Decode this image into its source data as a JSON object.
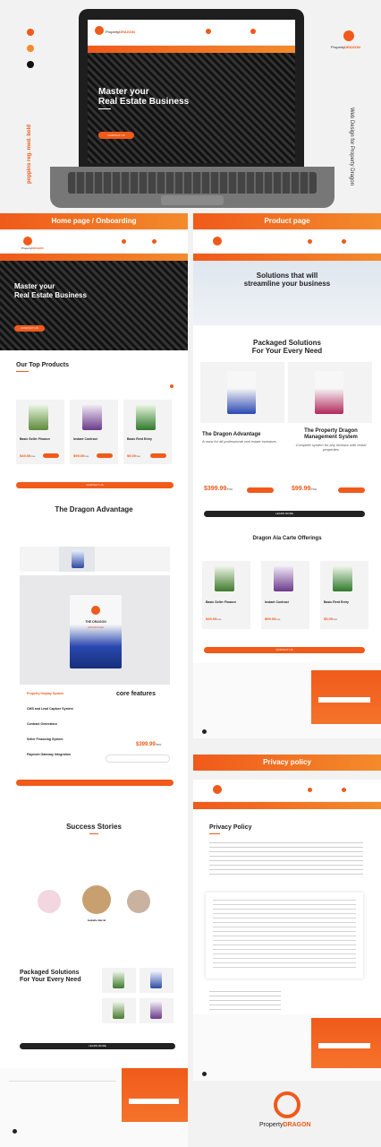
{
  "brand": {
    "name_left": "Property",
    "name_right": "DRAGON"
  },
  "side_text": {
    "fonts": "poppins reg. med. bold",
    "credit": "Web Design for Property Dragon"
  },
  "section_labels": {
    "home": "Home page / Onboarding",
    "product": "Product page",
    "privacy": "Privacy policy"
  },
  "laptop": {
    "hero_title_1": "Master your",
    "hero_title_2": "Real Estate Business",
    "hero_button": "CONTACT US"
  },
  "home": {
    "hero_title_1": "Master your",
    "hero_title_2": "Real Estate Business",
    "hero_button": "CONTACT US",
    "top_products_title": "Our Top Products",
    "products": [
      {
        "name": "Basic Seller Finance",
        "price": "$49.00",
        "unit": "/mo"
      },
      {
        "name": "Instant Contract",
        "price": "$99.00",
        "unit": "/mo"
      },
      {
        "name": "Basic Rent Entry",
        "price": "$9.00",
        "unit": "/mo"
      }
    ],
    "contact_button": "CONTACT US",
    "advantage_title": "The Dragon Advantage",
    "box_label_1": "THE DRAGON",
    "box_label_2": "ADVANTAGE",
    "features_list": [
      "Property Display System",
      "CMS and Lead Capture System",
      "Contract Generation",
      "Seller Financing System",
      "Payment Gateway Integration"
    ],
    "core_features_title": "core features",
    "core_price": "$399.99",
    "core_price_unit": "/mo",
    "success_title": "Success Stories",
    "testimonial_name": "Isabelle Berrel",
    "packaged_title_1": "Packaged Solutions",
    "packaged_title_2": "For Your Every Need",
    "learn_more": "LEARN MORE"
  },
  "product": {
    "hero_title_1": "Solutions that will",
    "hero_title_2": "streamline your business",
    "packaged_title_1": "Packaged Solutions",
    "packaged_title_2": "For Your Every Need",
    "plan_1_title": "The Dragon Advantage",
    "plan_1_sub": "A must for all professional real estate investors",
    "plan_1_price": "$399.99",
    "plan_1_unit": "/mo",
    "plan_2_title_1": "The Property Dragon",
    "plan_2_title_2": "Management System",
    "plan_2_sub": "Complete system for any investor with rental properties",
    "plan_2_price": "$99.99",
    "plan_2_unit": "/mo",
    "learn_more": "LEARN MORE",
    "ala_carte_title": "Dragon Ala Carte Offerings",
    "ala_products": [
      {
        "name": "Basic Seller Finance",
        "price": "$49.00",
        "unit": "/mo"
      },
      {
        "name": "Instant Contract",
        "price": "$99.00",
        "unit": "/mo"
      },
      {
        "name": "Basic Rent Entry",
        "price": "$9.00",
        "unit": "/mo"
      }
    ],
    "contact_button": "CONTACT US"
  },
  "privacy": {
    "title": "Privacy Policy"
  },
  "colors": {
    "accent": "#f05a1a",
    "accent_light": "#f38b2c",
    "dark": "#222222"
  }
}
